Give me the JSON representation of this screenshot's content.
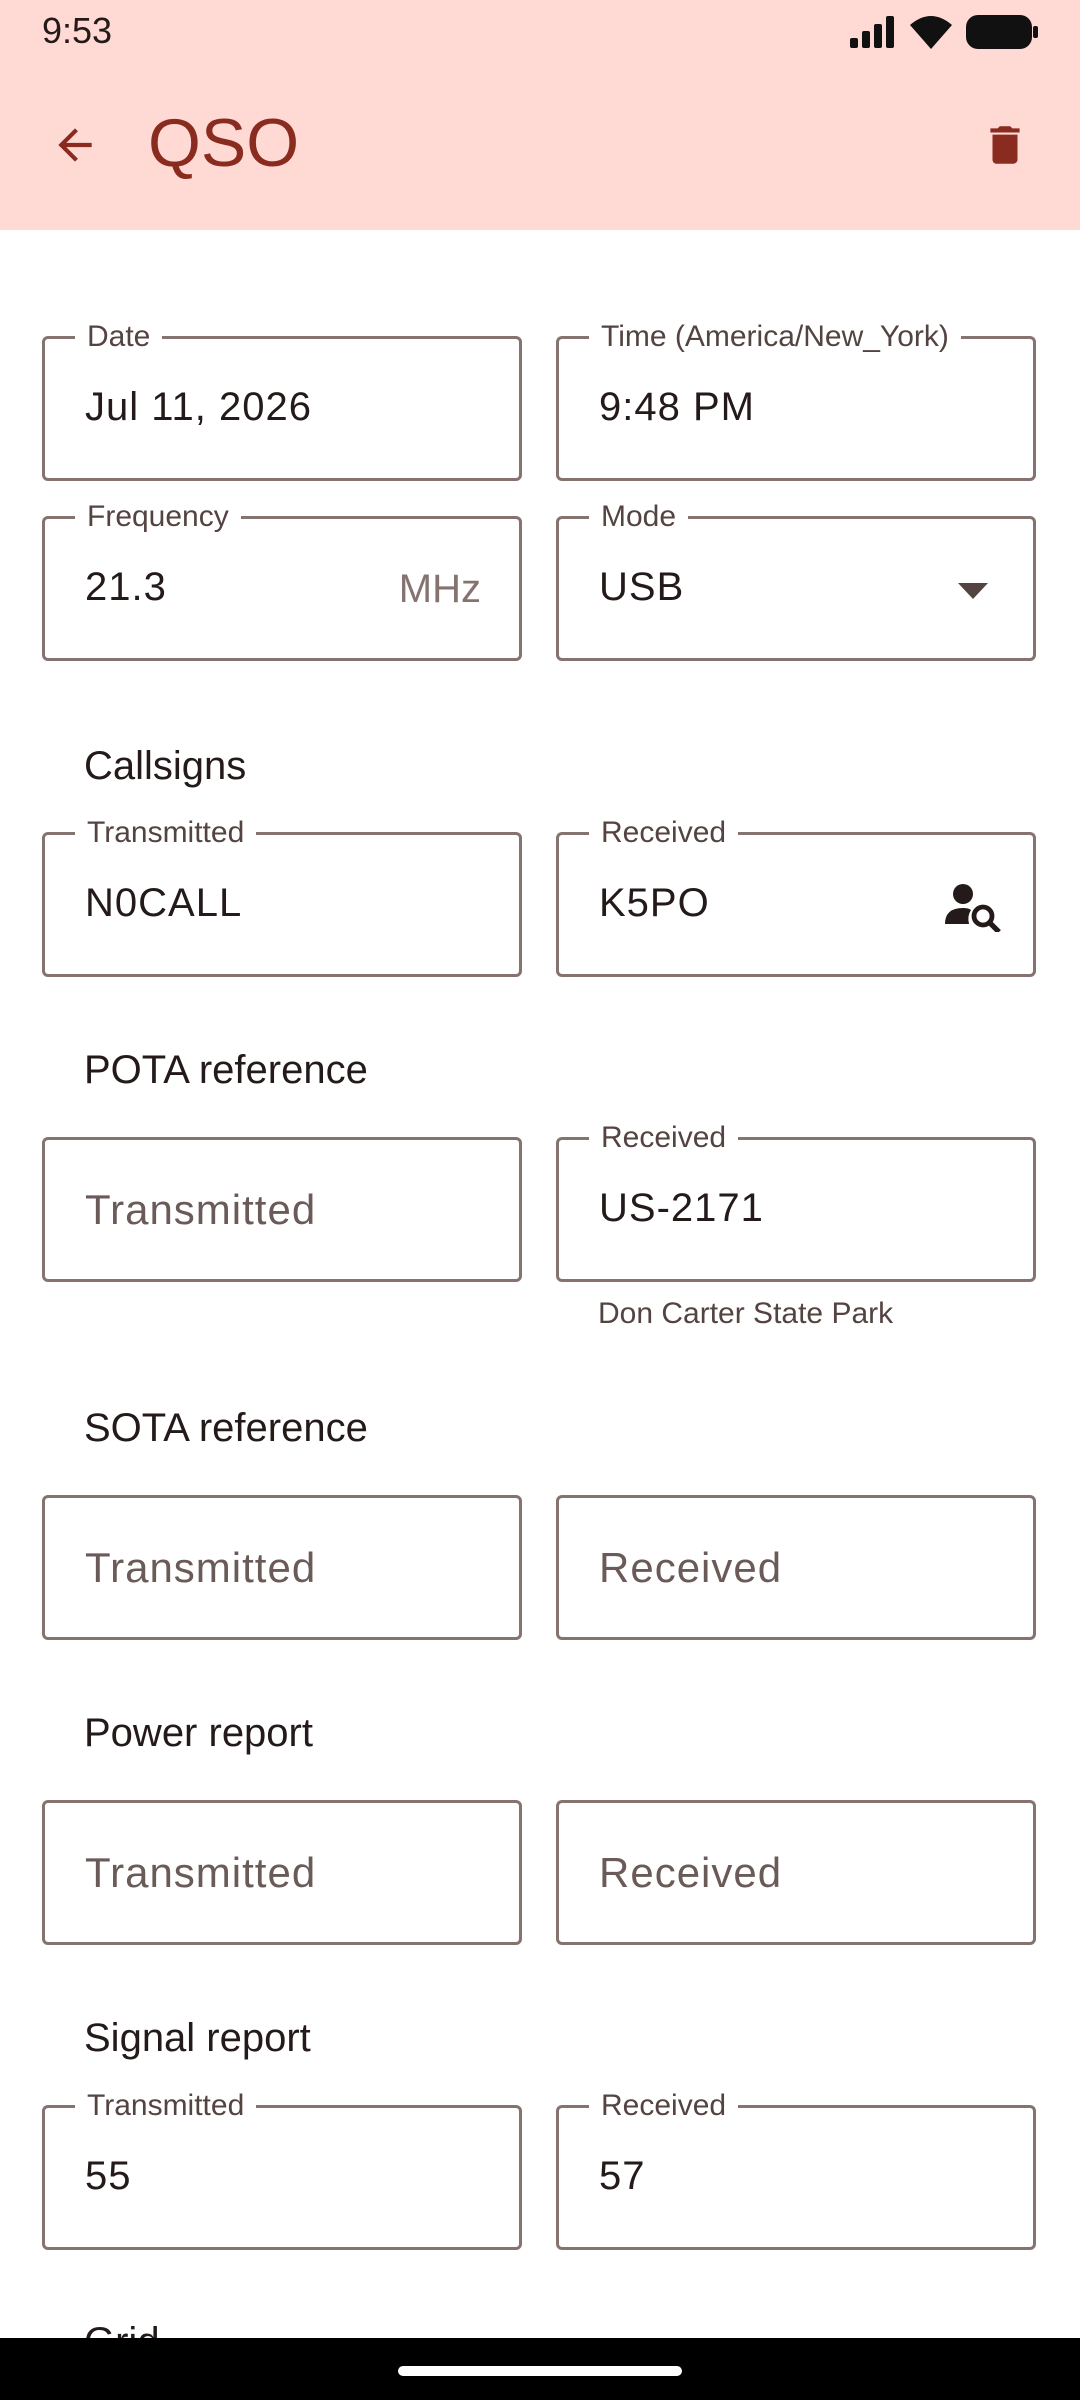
{
  "status_bar": {
    "time": "9:53"
  },
  "app_bar": {
    "title": "QSO"
  },
  "fields": {
    "date": {
      "label": "Date",
      "value": "Jul 11, 2026"
    },
    "time": {
      "label": "Time (America/New_York)",
      "value": "9:48 PM"
    },
    "frequency": {
      "label": "Frequency",
      "value": "21.3",
      "suffix": "MHz"
    },
    "mode": {
      "label": "Mode",
      "value": "USB"
    }
  },
  "sections": {
    "callsigns": {
      "title": "Callsigns",
      "transmitted": {
        "label": "Transmitted",
        "value": "N0CALL"
      },
      "received": {
        "label": "Received",
        "value": "K5PO"
      }
    },
    "pota": {
      "title": "POTA reference",
      "transmitted": {
        "placeholder": "Transmitted"
      },
      "received": {
        "label": "Received",
        "value": "US-2171",
        "support": "Don Carter State Park"
      }
    },
    "sota": {
      "title": "SOTA reference",
      "transmitted": {
        "placeholder": "Transmitted"
      },
      "received": {
        "placeholder": "Received"
      }
    },
    "power": {
      "title": "Power report",
      "transmitted": {
        "placeholder": "Transmitted"
      },
      "received": {
        "placeholder": "Received"
      }
    },
    "signal": {
      "title": "Signal report",
      "transmitted": {
        "label": "Transmitted",
        "value": "55"
      },
      "received": {
        "label": "Received",
        "value": "57"
      }
    }
  },
  "partial_next_section": "Grid",
  "colors": {
    "app_bar": "#ffdad5",
    "title": "#8a2b1f",
    "outline": "#857370"
  },
  "icons": [
    "back-arrow-icon",
    "delete-icon",
    "dropdown-arrow-icon",
    "person-search-icon",
    "signal-icon",
    "wifi-icon",
    "battery-icon"
  ]
}
